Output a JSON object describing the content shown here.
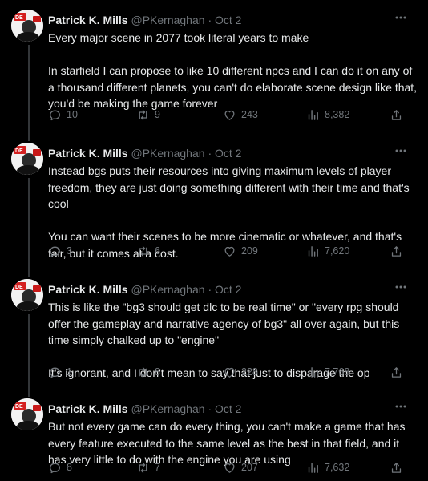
{
  "tweets": [
    {
      "name": "Patrick K. Mills",
      "handle": "@PKernaghan",
      "separator": "·",
      "time": "Oct 2",
      "paragraphs": [
        "Every major scene in 2077 took literal years to make",
        "In starfield I can propose to like 10 different npcs and I can do it on any of a thousand different planets, you can't do elaborate scene design like that, you'd be making the game forever"
      ],
      "replies": "10",
      "reposts": "9",
      "likes": "243",
      "views": "8,382"
    },
    {
      "name": "Patrick K. Mills",
      "handle": "@PKernaghan",
      "separator": "·",
      "time": "Oct 2",
      "paragraphs": [
        "Instead bgs puts their resources into giving maximum levels of player freedom, they are just doing something different with their time and that's cool",
        "You can want their scenes to be more cinematic or whatever, and that's fair, but it comes at a cost."
      ],
      "replies": "3",
      "reposts": "6",
      "likes": "209",
      "views": "7,620"
    },
    {
      "name": "Patrick K. Mills",
      "handle": "@PKernaghan",
      "separator": "·",
      "time": "Oct 2",
      "paragraphs": [
        "This is like the \"bg3 should get dlc to be real time\" or \"every rpg should offer the gameplay and narrative agency of bg3\" all over again, but this time simply chalked up to \"engine\"",
        "It's ignorant, and I don't mean to say that just to disparage the op"
      ],
      "replies": "1",
      "reposts": "8",
      "likes": "228",
      "views": "7,768"
    },
    {
      "name": "Patrick K. Mills",
      "handle": "@PKernaghan",
      "separator": "·",
      "time": "Oct 2",
      "paragraphs": [
        "But not every game can do every thing, you can't make a game that has every feature executed to the same level as the best in that field, and it has very little to do with the engine you are using"
      ],
      "replies": "8",
      "reposts": "7",
      "likes": "207",
      "views": "7,632"
    }
  ],
  "colors": {
    "background": "#000000",
    "text": "#e7e9ea",
    "muted": "#71767b",
    "thread_line": "#333639"
  },
  "icons": [
    "more-icon",
    "reply-icon",
    "repost-icon",
    "like-icon",
    "views-icon",
    "share-icon"
  ]
}
